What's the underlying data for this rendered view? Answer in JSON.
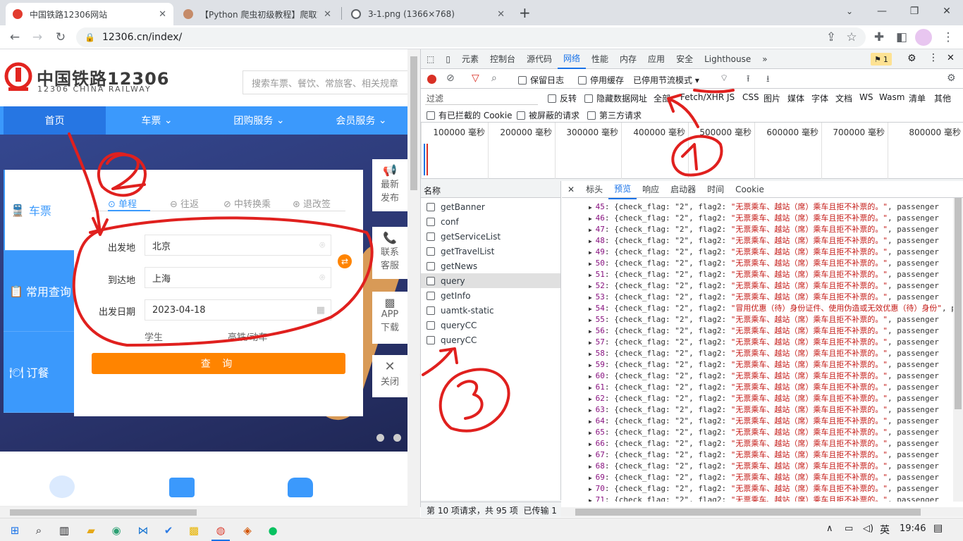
{
  "tabs": [
    {
      "title": "中国铁路12306网站",
      "color": "#e23b2e"
    },
    {
      "title": "【Python 爬虫初级教程】爬取12",
      "color": "#c58b69"
    },
    {
      "title": "3-1.png (1366×768)",
      "color": "#5f6368"
    }
  ],
  "url": "12306.cn/index/",
  "site": {
    "logo_title": "中国铁路12306",
    "logo_subtitle": "12306 CHINA RAILWAY",
    "search_placeholder": "搜索车票、餐饮、常旅客、相关规章",
    "menu": [
      "首页",
      "车票",
      "团购服务",
      "会员服务"
    ],
    "side_tabs": [
      "车票",
      "常用查询",
      "订餐"
    ],
    "trip_types": [
      "单程",
      "往返",
      "中转换乘",
      "退改签"
    ],
    "from_label": "出发地",
    "from_value": "北京",
    "to_label": "到达地",
    "to_value": "上海",
    "date_label": "出发日期",
    "date_value": "2023-04-18",
    "student": "学生",
    "highspeed": "高铁/动车",
    "query_button": "查 询",
    "float_items": [
      "最新发布",
      "联系客服",
      "APP下载",
      "关闭"
    ]
  },
  "devtools": {
    "tabs": [
      "元素",
      "控制台",
      "源代码",
      "网络",
      "性能",
      "内存",
      "应用",
      "安全",
      "Lighthouse"
    ],
    "badge": "1",
    "toolbar2": {
      "preserve_log": "保留日志",
      "disable_cache": "停用缓存",
      "throttle": "已停用节流模式"
    },
    "filter_placeholder": "过滤",
    "filter_options": [
      "反转",
      "隐藏数据网址",
      "全部",
      "Fetch/XHR",
      "JS",
      "CSS",
      "图片",
      "媒体",
      "字体",
      "文档",
      "WS",
      "Wasm",
      "清单",
      "其他"
    ],
    "filter_row2": [
      "有已拦截的 Cookie",
      "被屏蔽的请求",
      "第三方请求"
    ],
    "timeline_ticks": [
      "100000 毫秒",
      "200000 毫秒",
      "300000 毫秒",
      "400000 毫秒",
      "500000 毫秒",
      "600000 毫秒",
      "700000 毫秒",
      "800000 毫秒"
    ],
    "name_header": "名称",
    "requests": [
      "getBanner",
      "conf",
      "getServiceList",
      "getTravelList",
      "getNews",
      "query",
      "getInfo",
      "uamtk-static",
      "queryCC",
      "queryCC"
    ],
    "selected_request": "query",
    "detail_tabs": [
      "标头",
      "预览",
      "响应",
      "启动器",
      "时间",
      "Cookie"
    ],
    "status": "第 10 项请求，共 95 项",
    "status2": "已传输 1",
    "preview_lines": [
      {
        "n": "45",
        "flag2": "无票乘车、越站（席）乘车且拒不补票的。"
      },
      {
        "n": "46",
        "flag2": "无票乘车、越站（席）乘车且拒不补票的。"
      },
      {
        "n": "47",
        "flag2": "无票乘车、越站（席）乘车且拒不补票的。"
      },
      {
        "n": "48",
        "flag2": "无票乘车、越站（席）乘车且拒不补票的。"
      },
      {
        "n": "49",
        "flag2": "无票乘车、越站（席）乘车且拒不补票的。"
      },
      {
        "n": "50",
        "flag2": "无票乘车、越站（席）乘车且拒不补票的。"
      },
      {
        "n": "51",
        "flag2": "无票乘车、越站（席）乘车且拒不补票的。"
      },
      {
        "n": "52",
        "flag2": "无票乘车、越站（席）乘车且拒不补票的。"
      },
      {
        "n": "53",
        "flag2": "无票乘车、越站（席）乘车且拒不补票的。"
      },
      {
        "n": "54",
        "flag2": "冒用优惠（待）身份证件、使用伪造或无效优惠（待）身份"
      },
      {
        "n": "55",
        "flag2": "无票乘车、越站（席）乘车且拒不补票的。"
      },
      {
        "n": "56",
        "flag2": "无票乘车、越站（席）乘车且拒不补票的。"
      },
      {
        "n": "57",
        "flag2": "无票乘车、越站（席）乘车且拒不补票的。"
      },
      {
        "n": "58",
        "flag2": "无票乘车、越站（席）乘车且拒不补票的。"
      },
      {
        "n": "59",
        "flag2": "无票乘车、越站（席）乘车且拒不补票的。"
      },
      {
        "n": "60",
        "flag2": "无票乘车、越站（席）乘车且拒不补票的。"
      },
      {
        "n": "61",
        "flag2": "无票乘车、越站（席）乘车且拒不补票的。"
      },
      {
        "n": "62",
        "flag2": "无票乘车、越站（席）乘车且拒不补票的。"
      },
      {
        "n": "63",
        "flag2": "无票乘车、越站（席）乘车且拒不补票的。"
      },
      {
        "n": "64",
        "flag2": "无票乘车、越站（席）乘车且拒不补票的。"
      },
      {
        "n": "65",
        "flag2": "无票乘车、越站（席）乘车且拒不补票的。"
      },
      {
        "n": "66",
        "flag2": "无票乘车、越站（席）乘车且拒不补票的。"
      },
      {
        "n": "67",
        "flag2": "无票乘车、越站（席）乘车且拒不补票的。"
      },
      {
        "n": "68",
        "flag2": "无票乘车、越站（席）乘车且拒不补票的。"
      },
      {
        "n": "69",
        "flag2": "无票乘车、越站（席）乘车且拒不补票的。"
      },
      {
        "n": "70",
        "flag2": "无票乘车、越站（席）乘车且拒不补票的。"
      },
      {
        "n": "71",
        "flag2": "无票乘车、越站（席）乘车且拒不补票的。"
      }
    ],
    "preview_prefix_flag": "{check_flag: \"2\", flag2: ",
    "preview_suffix": ", passenger"
  },
  "taskbar": {
    "ime": "英",
    "time": "19:46"
  },
  "annotations": {
    "colors": {
      "ink": "#e0201e"
    }
  }
}
